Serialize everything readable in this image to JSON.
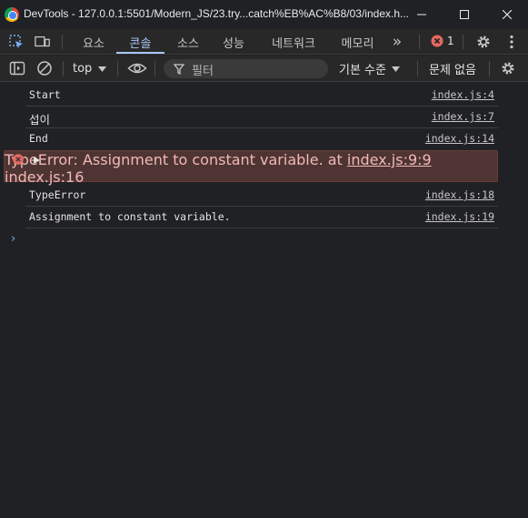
{
  "window": {
    "title": "DevTools - 127.0.0.1:5501/Modern_JS/23.try...catch%EB%AC%B8/03/index.h...",
    "minimize_glyph": "—",
    "maximize_glyph": "☐",
    "close_glyph": "✕"
  },
  "tabs": {
    "items": [
      {
        "label": "요소"
      },
      {
        "label": "콘솔"
      },
      {
        "label": "소스"
      },
      {
        "label": "성능"
      },
      {
        "label": "네트워크"
      },
      {
        "label": "메모리"
      }
    ],
    "active_index": 1,
    "more_glyph": "»",
    "error_count": "1"
  },
  "toolbar": {
    "context": "top",
    "filter_placeholder": "필터",
    "levels": "기본 수준",
    "issues": "문제 없음"
  },
  "console": {
    "rows": [
      {
        "message": "Start",
        "source": "index.js:4"
      },
      {
        "message": "섭이",
        "source": "index.js:7"
      },
      {
        "message": "End",
        "source": "index.js:14"
      },
      {
        "message": "TypeError: Assignment to constant variable.",
        "stack_prefix": "    at ",
        "stack_link": "index.js:9:9",
        "source": "index.js:16",
        "level": "error"
      },
      {
        "message": "TypeError",
        "source": "index.js:18"
      },
      {
        "message": "Assignment to constant variable.",
        "source": "index.js:19"
      }
    ],
    "prompt_glyph": "›"
  },
  "colors": {
    "accent": "#a8c7fa",
    "error_bg": "#4e3534",
    "error_text": "#f2b8b5",
    "error_badge": "#e46962"
  },
  "icons": [
    "chrome-logo",
    "inspect-element-icon",
    "device-toolbar-icon",
    "error-icon",
    "settings-icon",
    "more-options-icon",
    "sidebar-toggle-icon",
    "clear-console-icon",
    "eye-icon",
    "filter-icon",
    "console-settings-icon",
    "expand-triangle-icon",
    "prompt-chevron-icon"
  ]
}
